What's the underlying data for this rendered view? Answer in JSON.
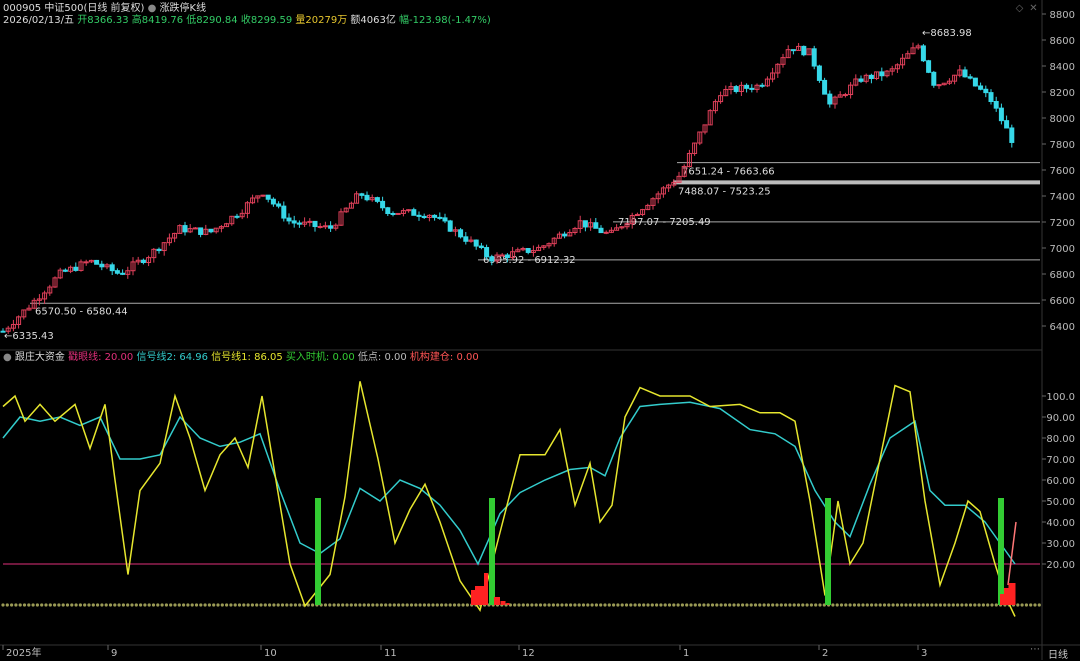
{
  "header": {
    "code": "000905",
    "name": "中证500",
    "period": "(日线 前复权)",
    "overlay": "涨跌停K线",
    "date": "2026/02/13/五",
    "open_label": "开",
    "open": "8366.33",
    "high_label": "高",
    "high": "8419.76",
    "low_label": "低",
    "low": "8290.84",
    "close_label": "收",
    "close": "8299.59",
    "vol_label": "量",
    "vol": "20279万",
    "amt_label": "额",
    "amt": "4063亿",
    "chg_label": "幅",
    "chg": "-123.98(-1.47%)"
  },
  "indicator": {
    "name": "跟庄大资金",
    "items": [
      {
        "label": "戳眼线: 20.00",
        "color": "#e0307a"
      },
      {
        "label": "信号线2: 64.96",
        "color": "#33cccc"
      },
      {
        "label": "信号线1: 86.05",
        "color": "#e6e62e"
      },
      {
        "label": "买入时机: 0.00",
        "color": "#33cc33"
      },
      {
        "label": "低点: 0.00",
        "color": "#bbbbbb"
      },
      {
        "label": "机构建仓: 0.00",
        "color": "#ff5555"
      }
    ]
  },
  "price_axis": [
    "8800",
    "8600",
    "8400",
    "8200",
    "8000",
    "7800",
    "7600",
    "7400",
    "7200",
    "7000",
    "6800",
    "6600",
    "6400"
  ],
  "ind_axis": [
    "100.0",
    "90.00",
    "80.00",
    "70.00",
    "60.00",
    "50.00",
    "40.00",
    "30.00",
    "20.00"
  ],
  "time_axis": [
    "2025年",
    "9",
    "10",
    "11",
    "12",
    "1",
    "2",
    "3"
  ],
  "period_label": "日线",
  "annotations": {
    "low_marker": "6335.43",
    "high_marker": "8683.98",
    "zones": [
      "6570.50 - 6580.44",
      "6905.92 - 6912.32",
      "7197.07 - 7205.49",
      "7488.07 - 7523.25",
      "7651.24 - 7663.66"
    ]
  },
  "colors": {
    "up": "#e0405a",
    "down": "#36d8e8",
    "line1": "#e6e62e",
    "line2": "#33cccc",
    "buy": "#33cc33",
    "build": "#ff2222",
    "poke": "#e0307a"
  }
}
